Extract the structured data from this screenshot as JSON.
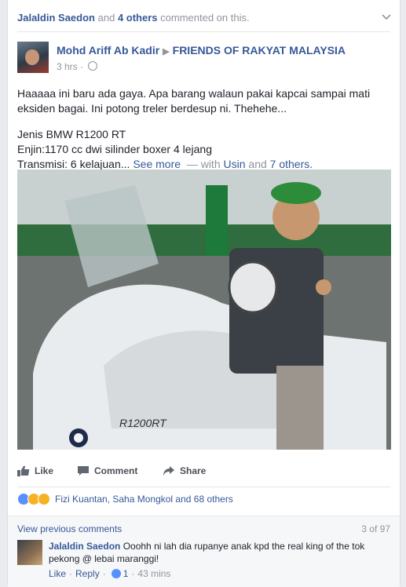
{
  "notification": {
    "actor": "Jalaldin Saedon",
    "connector": "and",
    "others": "4 others",
    "suffix": "commented on this."
  },
  "post": {
    "author": "Mohd Ariff Ab Kadir",
    "group": "FRIENDS OF RAKYAT MALAYSIA",
    "time": "3 hrs",
    "text_line1": "Haaaaa ini baru ada gaya. Apa barang walaun pakai kapcai sampai mati",
    "text_line2": "eksiden bagai. Ini potong treler berdesup ni. Thehehe...",
    "spec1": "Jenis BMW R1200 RT",
    "spec2": "Enjin:1170 cc dwi silinder boxer 4 lejang",
    "spec3": "Transmisi: 6 kelajuan...",
    "see_more": "See more",
    "with_text": "— with",
    "tag1": "Usin",
    "and_text": "and",
    "tag2": "7 others."
  },
  "actions": {
    "like": "Like",
    "comment": "Comment",
    "share": "Share"
  },
  "reactions": {
    "text": "Fizi Kuantan, Saha Mongkol and 68 others",
    "emoji_colors": [
      "#5890ff",
      "#f7b125",
      "#f7b125"
    ]
  },
  "comments": {
    "view_previous": "View previous comments",
    "count": "3 of 97",
    "items": [
      {
        "name": "Jalaldin Saedon",
        "text": "Ooohh ni lah dia rupanye anak kpd the real king of the tok pekong @ lebai maranggi!",
        "like": "Like",
        "reply": "Reply",
        "likes": "1",
        "time": "43 mins"
      }
    ]
  }
}
